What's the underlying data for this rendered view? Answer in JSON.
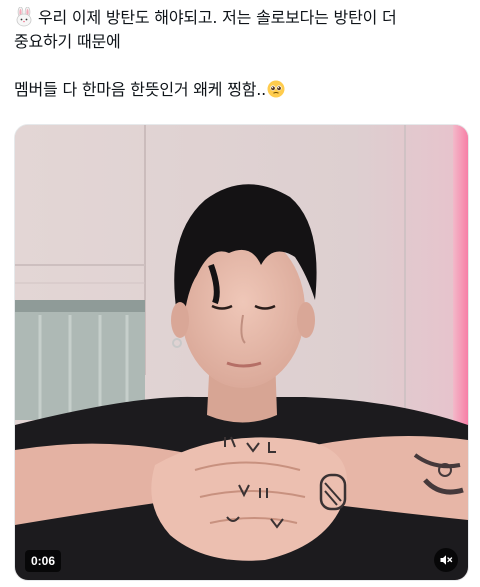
{
  "tweet": {
    "line1": "우리 이제 방탄도 해야되고. 저는 솔로보다는 방탄이 더",
    "line2": "중요하기 때문에",
    "line3": "멤버들 다 한마음 한뜻인거 왜케 찡함..",
    "leading_emoji": "rabbit-face-icon",
    "trailing_emoji": "pleading-face-icon"
  },
  "video": {
    "duration": "0:06",
    "sound_icon": "muted-speaker-icon"
  }
}
